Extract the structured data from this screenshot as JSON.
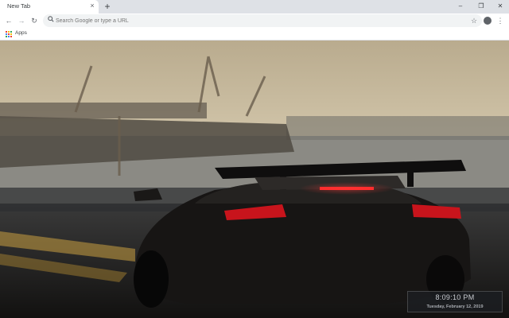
{
  "browser": {
    "tab_title": "New Tab",
    "tab_close_glyph": "×",
    "new_tab_glyph": "+",
    "window_controls": {
      "minimize": "–",
      "maximize": "❐",
      "close": "✕"
    }
  },
  "toolbar": {
    "back_glyph": "←",
    "forward_glyph": "→",
    "reload_glyph": "↻",
    "search_placeholder": "Search Google or type a URL",
    "search_icon": "search-icon",
    "bookmark_glyph": "☆",
    "menu_glyph": "⋮"
  },
  "bookmarks": {
    "apps_label": "Apps"
  },
  "clock": {
    "time": "8:09:10 PM",
    "date": "Tuesday, February 12, 2019"
  },
  "colors": {
    "tabstrip": "#dee1e6",
    "taillight": "#e0222a",
    "sky": "#d9cdb2"
  }
}
